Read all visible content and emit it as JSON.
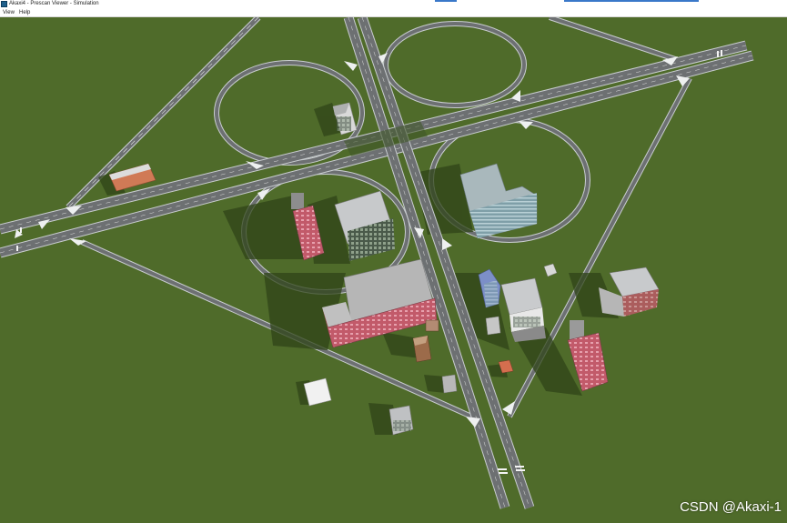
{
  "window": {
    "title": "Akaxi4 - Prescan Viewer - Simulation",
    "icon": "prescan-app-icon"
  },
  "menu": {
    "items": [
      {
        "label": "View"
      },
      {
        "label": "Help"
      }
    ]
  },
  "scene": {
    "ground_color": "#4f6b2a",
    "road_color": "#6d7072",
    "road_edge_color": "#c9cdd0",
    "description_icons": [
      "road-network",
      "buildings"
    ]
  },
  "watermark": {
    "text": "CSDN @Akaxi-1"
  }
}
